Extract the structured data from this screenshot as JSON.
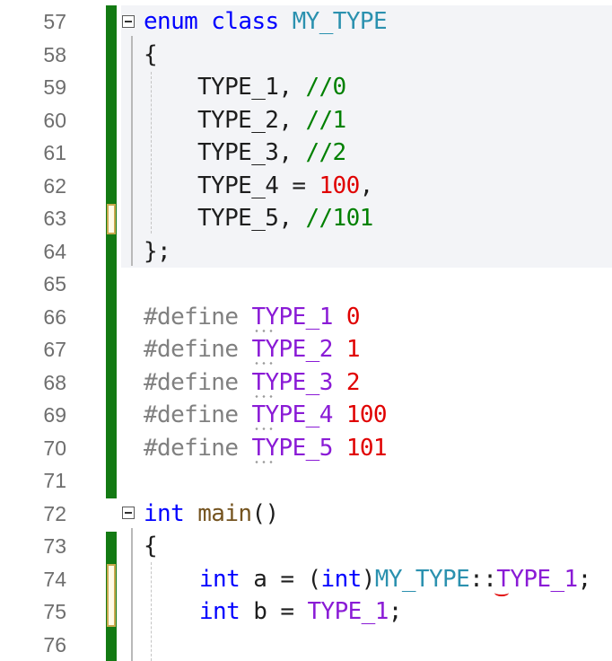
{
  "editor": {
    "line_numbers": [
      "57",
      "58",
      "59",
      "60",
      "61",
      "62",
      "63",
      "64",
      "65",
      "66",
      "67",
      "68",
      "69",
      "70",
      "71",
      "72",
      "73",
      "74",
      "75",
      "76"
    ],
    "lines": {
      "l57": {
        "kw_enum": "enum",
        "kw_class": "class",
        "name": "MY_TYPE"
      },
      "l58": {
        "brace": "{"
      },
      "l59": {
        "member": "TYPE_1",
        "sep": ",",
        "comment": "//0"
      },
      "l60": {
        "member": "TYPE_2",
        "sep": ",",
        "comment": "//1"
      },
      "l61": {
        "member": "TYPE_3",
        "sep": ",",
        "comment": "//2"
      },
      "l62": {
        "member": "TYPE_4",
        "assign": " = ",
        "value": "100",
        "sep": ","
      },
      "l63": {
        "member": "TYPE_5",
        "sep": ",",
        "comment": "//101"
      },
      "l64": {
        "close": "};"
      },
      "l66": {
        "directive": "#define",
        "macro": "TYPE_1",
        "value": "0"
      },
      "l67": {
        "directive": "#define",
        "macro": "TYPE_2",
        "value": "1"
      },
      "l68": {
        "directive": "#define",
        "macro": "TYPE_3",
        "value": "2"
      },
      "l69": {
        "directive": "#define",
        "macro": "TYPE_4",
        "value": "100"
      },
      "l70": {
        "directive": "#define",
        "macro": "TYPE_5",
        "value": "101"
      },
      "l72": {
        "kw_int": "int",
        "fn": "main",
        "parens": "()"
      },
      "l73": {
        "brace": "{"
      },
      "l74": {
        "kw_int": "int",
        "var": "a",
        "eq": " = ",
        "lparen": "(",
        "cast": "int",
        "rparen": ")",
        "type": "MY_TYPE",
        "scope": "::",
        "t_first": "T",
        "t_rest": "YPE_1",
        "end": ";"
      },
      "l75": {
        "kw_int": "int",
        "var": "b",
        "eq": " = ",
        "macro": "TYPE_1",
        "end": ";"
      }
    }
  },
  "colors": {
    "keyword": "#0000ff",
    "type": "#2b91af",
    "number": "#e00000",
    "comment": "#008000",
    "macro": "#8a1bd6",
    "change_bar": "#137a13"
  }
}
